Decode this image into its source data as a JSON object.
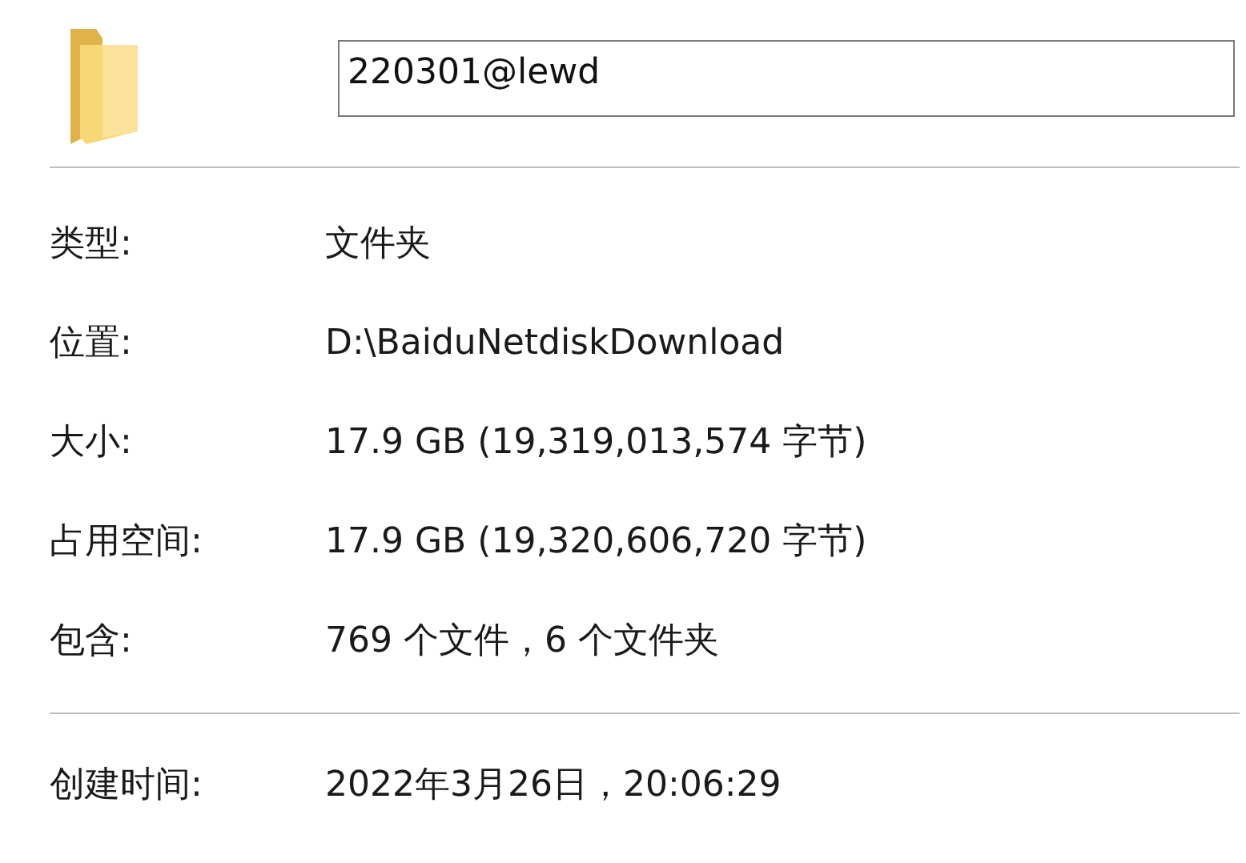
{
  "name_field": {
    "value": "220301@lewd"
  },
  "properties": [
    {
      "label": "类型:",
      "value": "文件夹"
    },
    {
      "label": "位置:",
      "value": "D:\\BaiduNetdiskDownload"
    },
    {
      "label": "大小:",
      "value": "17.9 GB (19,319,013,574 字节)"
    },
    {
      "label": "占用空间:",
      "value": "17.9 GB (19,320,606,720 字节)"
    },
    {
      "label": "包含:",
      "value": "769 个文件，6 个文件夹"
    }
  ],
  "dates": [
    {
      "label": "创建时间:",
      "value": "2022年3月26日，20:06:29"
    }
  ]
}
